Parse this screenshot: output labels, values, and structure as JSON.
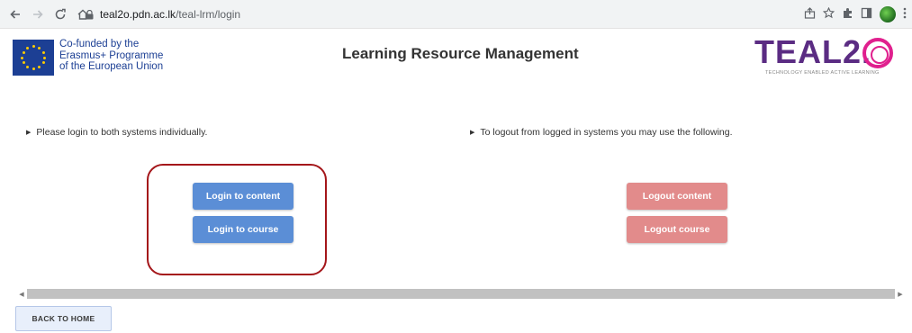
{
  "browser": {
    "url_host": "teal2o.pdn.ac.lk",
    "url_path": "/teal-lrm/login"
  },
  "header": {
    "eu_text_lines": [
      "Co-funded by the",
      "Erasmus+ Programme",
      "of the European Union"
    ],
    "title": "Learning Resource Management",
    "logo_word": "TEAL2.",
    "logo_tagline": "TECHNOLOGY ENABLED ACTIVE LEARNING"
  },
  "left_panel": {
    "instruction": "Please login to both systems individually.",
    "login_content_label": "Login to content",
    "login_course_label": "Login to course"
  },
  "right_panel": {
    "instruction": "To logout from logged in systems you may use the following.",
    "logout_content_label": "Logout content",
    "logout_course_label": "Logout course"
  },
  "footer": {
    "back_label": "BACK TO HOME"
  },
  "colors": {
    "login_button": "#5b8ed6",
    "logout_button": "#e28b8b",
    "highlight_border": "#a4161a",
    "logo_purple": "#5b2c83",
    "logo_pink": "#e0208e",
    "eu_blue": "#1c3f94"
  },
  "icons": {
    "back": "arrow-left-icon",
    "forward": "arrow-right-icon",
    "reload": "reload-icon",
    "home": "home-icon",
    "lock": "lock-icon",
    "share": "share-icon",
    "bookmark": "star-icon",
    "extensions": "puzzle-icon",
    "sidepanel": "sidepanel-icon",
    "menu": "kebab-menu-icon"
  }
}
